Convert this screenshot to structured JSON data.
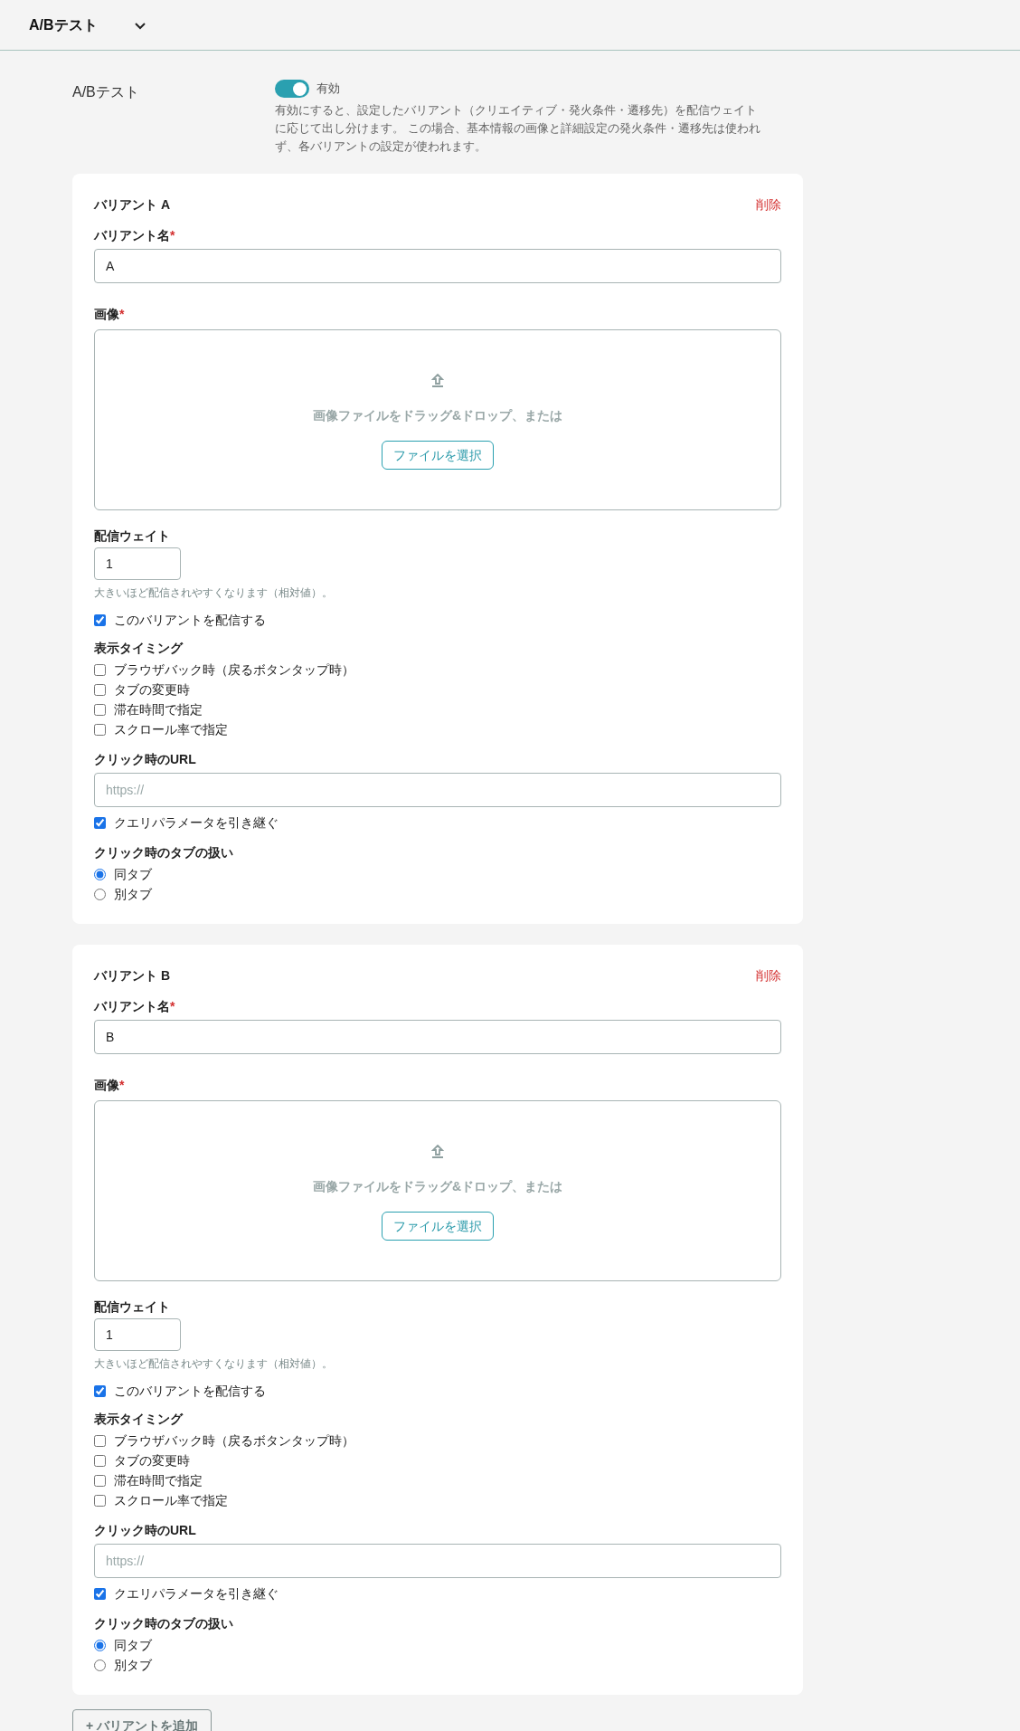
{
  "section": {
    "title": "A/Bテスト",
    "expanded": true
  },
  "ab_test": {
    "label": "A/Bテスト",
    "enabled": true,
    "status": "有効",
    "description": "有効にすると、設定したバリアント（クリエイティブ・発火条件・遷移先）を配信ウェイトに応じて出し分けます。 この場合、基本情報の画像と詳細設定の発火条件・遷移先は使われず、各バリアントの設定が使われます。"
  },
  "variants": [
    {
      "title": "バリアント A",
      "delete": "削除",
      "name_label": "バリアント名",
      "name_required": "*",
      "name_value": "A",
      "image_label": "画像",
      "image_required": "*",
      "dropzone_text": "画像ファイルをドラッグ&ドロップ、または",
      "file_button": "ファイルを選択",
      "weight_label": "配信ウェイト",
      "weight_value": "1",
      "weight_hint": "大きいほど配信されやすくなります（相対値）。",
      "deliver": {
        "label": "このバリアントを配信する",
        "checked": true
      },
      "timing_label": "表示タイミング",
      "timing_options": [
        {
          "label": "ブラウザバック時（戻るボタンタップ時）",
          "checked": false
        },
        {
          "label": "タブの変更時",
          "checked": false
        },
        {
          "label": "滞在時間で指定",
          "checked": false
        },
        {
          "label": "スクロール率で指定",
          "checked": false
        }
      ],
      "url_label": "クリック時のURL",
      "url_placeholder": "https://",
      "keep_query": {
        "label": "クエリパラメータを引き継ぐ",
        "checked": true
      },
      "tab_label": "クリック時のタブの扱い",
      "tab_options": [
        {
          "label": "同タブ",
          "selected": true
        },
        {
          "label": "別タブ",
          "selected": false
        }
      ]
    },
    {
      "title": "バリアント B",
      "delete": "削除",
      "name_label": "バリアント名",
      "name_required": "*",
      "name_value": "B",
      "image_label": "画像",
      "image_required": "*",
      "dropzone_text": "画像ファイルをドラッグ&ドロップ、または",
      "file_button": "ファイルを選択",
      "weight_label": "配信ウェイト",
      "weight_value": "1",
      "weight_hint": "大きいほど配信されやすくなります（相対値）。",
      "deliver": {
        "label": "このバリアントを配信する",
        "checked": true
      },
      "timing_label": "表示タイミング",
      "timing_options": [
        {
          "label": "ブラウザバック時（戻るボタンタップ時）",
          "checked": false
        },
        {
          "label": "タブの変更時",
          "checked": false
        },
        {
          "label": "滞在時間で指定",
          "checked": false
        },
        {
          "label": "スクロール率で指定",
          "checked": false
        }
      ],
      "url_label": "クリック時のURL",
      "url_placeholder": "https://",
      "keep_query": {
        "label": "クエリパラメータを引き継ぐ",
        "checked": true
      },
      "tab_label": "クリック時のタブの扱い",
      "tab_options": [
        {
          "label": "同タブ",
          "selected": true
        },
        {
          "label": "別タブ",
          "selected": false
        }
      ]
    }
  ],
  "add_button": "+ バリアントを追加"
}
